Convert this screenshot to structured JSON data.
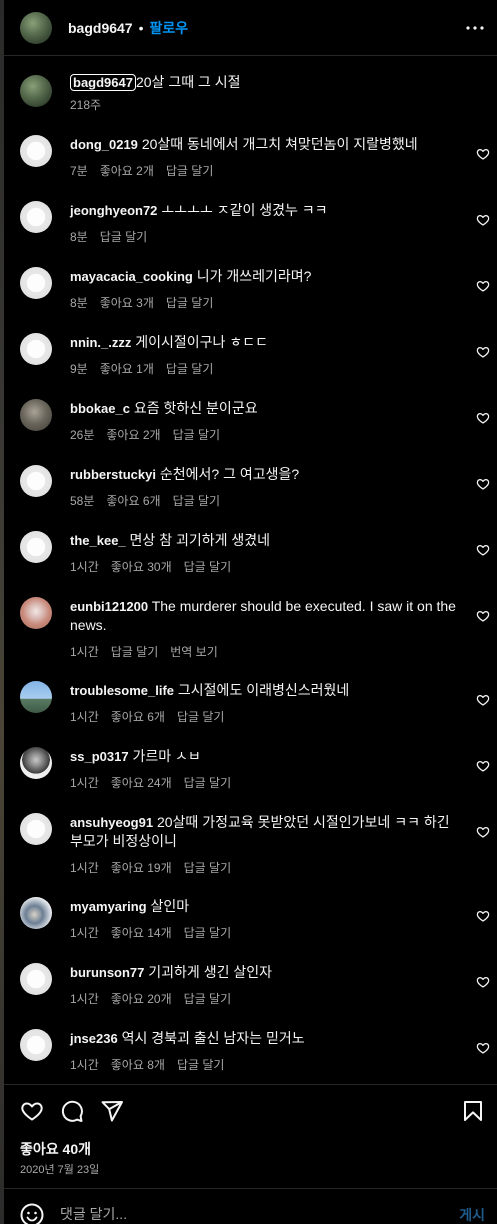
{
  "header": {
    "username": "bagd9647",
    "dot": "•",
    "follow_label": "팔로우"
  },
  "caption": {
    "username": "bagd9647",
    "text": "20살 그때 그 시절",
    "time": "218주"
  },
  "comments": [
    {
      "username": "dong_0219",
      "text": "20살때 동네에서 개그치 쳐맞던놈이 지랄병했네",
      "time": "7분",
      "likes": "좋아요 2개",
      "reply": "답글 달기",
      "avatar": "default-avatar"
    },
    {
      "username": "jeonghyeon72",
      "text": "ㅗㅗㅗㅗ ㅈ같이 생겼누 ㅋㅋ",
      "time": "8분",
      "likes": "",
      "reply": "답글 달기",
      "avatar": "default-avatar"
    },
    {
      "username": "mayacacia_cooking",
      "text": "니가 개쓰레기라며?",
      "time": "8분",
      "likes": "좋아요 3개",
      "reply": "답글 달기",
      "avatar": "default-avatar"
    },
    {
      "username": "nnin._.zzz",
      "text": "게이시절이구나 ㅎㄷㄷ",
      "time": "9분",
      "likes": "좋아요 1개",
      "reply": "답글 달기",
      "avatar": "default-avatar"
    },
    {
      "username": "bbokae_c",
      "text": "요즘 핫하신 분이군요",
      "time": "26분",
      "likes": "좋아요 2개",
      "reply": "답글 달기",
      "avatar": "cat-avatar"
    },
    {
      "username": "rubberstuckyi",
      "text": "순천에서? 그 여고생을?",
      "time": "58분",
      "likes": "좋아요 6개",
      "reply": "답글 달기",
      "avatar": "default-avatar"
    },
    {
      "username": "the_kee_",
      "text": "면상 참 괴기하게 생겼네",
      "time": "1시간",
      "likes": "좋아요 30개",
      "reply": "답글 달기",
      "avatar": "default-avatar"
    },
    {
      "username": "eunbi121200",
      "text": "The murderer should be executed. I saw it on the news.",
      "time": "1시간",
      "likes": "",
      "reply": "답글 달기",
      "translate": "번역 보기",
      "avatar": "food-avatar"
    },
    {
      "username": "troublesome_life",
      "text": "그시절에도 이래병신스러웠네",
      "time": "1시간",
      "likes": "좋아요 6개",
      "reply": "답글 달기",
      "avatar": "sky-avatar"
    },
    {
      "username": "ss_p0317",
      "text": "가르마 ㅅㅂ",
      "time": "1시간",
      "likes": "좋아요 24개",
      "reply": "답글 달기",
      "avatar": "man-avatar"
    },
    {
      "username": "ansuhyeog91",
      "text": "20살때 가정교육 못받았던 시절인가보네 ㅋㅋ 하긴 부모가 비정상이니",
      "time": "1시간",
      "likes": "좋아요 19개",
      "reply": "답글 달기",
      "avatar": "default-avatar"
    },
    {
      "username": "myamyaring",
      "text": "살인마",
      "time": "1시간",
      "likes": "좋아요 14개",
      "reply": "답글 달기",
      "avatar": "girl-avatar"
    },
    {
      "username": "burunson77",
      "text": "기괴하게 생긴 살인자",
      "time": "1시간",
      "likes": "좋아요 20개",
      "reply": "답글 달기",
      "avatar": "default-avatar"
    },
    {
      "username": "jnse236",
      "text": "역시 경북괴 출신 남자는 믿거노",
      "time": "1시간",
      "likes": "좋아요 8개",
      "reply": "답글 달기",
      "avatar": "default-avatar"
    }
  ],
  "footer": {
    "likes": "좋아요 40개",
    "date": "2020년 7월 23일",
    "comment_placeholder": "댓글 달기...",
    "post_label": "게시"
  },
  "icons": [
    "more-icon",
    "heart-icon",
    "comment-icon",
    "share-icon",
    "bookmark-icon",
    "emoji-icon"
  ],
  "colors": {
    "background": "#000000",
    "text": "#f5f5f5",
    "secondary": "#a8a8a8",
    "accent": "#0095f6",
    "post_disabled": "#1f5b8a"
  }
}
